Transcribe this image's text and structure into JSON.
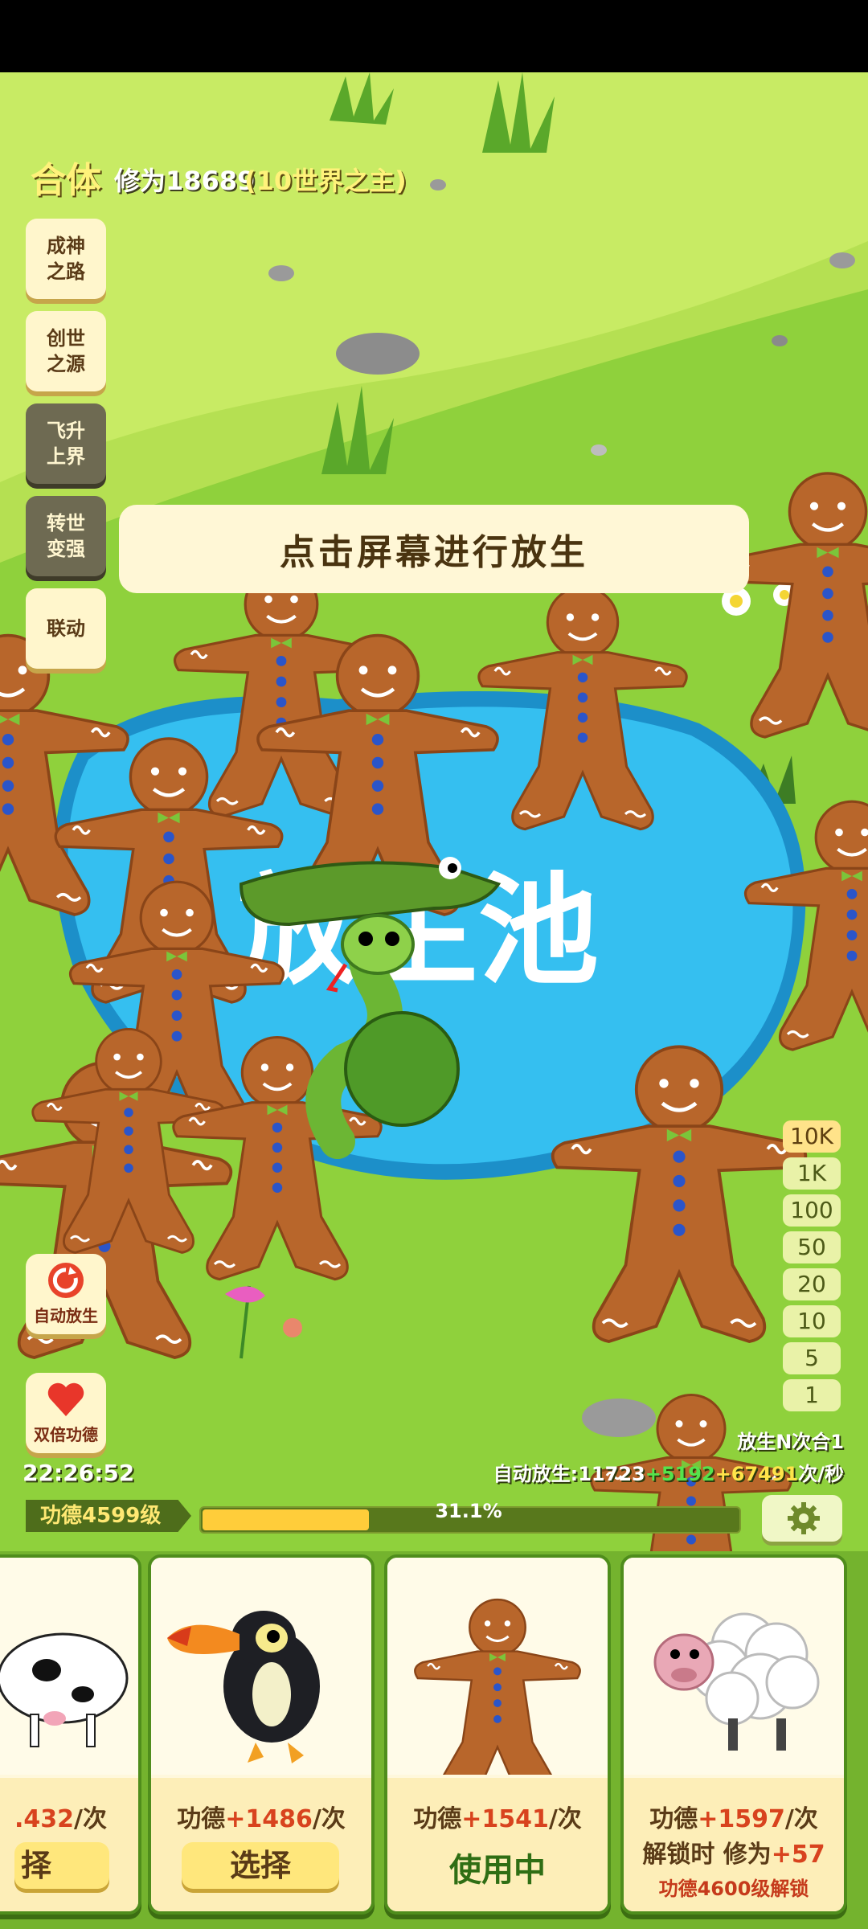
{
  "header": {
    "realm": "合体",
    "cultivation": "修为18689",
    "world_title": "(10世界之主)"
  },
  "menu": [
    {
      "label": "成神\n之路",
      "locked": false
    },
    {
      "label": "创世\n之源",
      "locked": false
    },
    {
      "label": "飞升\n上界",
      "locked": true
    },
    {
      "label": "转世\n变强",
      "locked": true
    },
    {
      "label": "联动",
      "locked": false
    }
  ],
  "hint": "点击屏幕进行放生",
  "pond_label": "放生池",
  "quantities": [
    "10K",
    "1K",
    "100",
    "50",
    "20",
    "10",
    "5",
    "1"
  ],
  "selected_quantity": "10K",
  "auto_release_button": "自动放生",
  "double_merit_button": "双倍功德",
  "timer": "22:26:52",
  "release_n_combine": "放生N次合1",
  "auto_rate": {
    "prefix": "自动放生:11723",
    "bonus1": "+5192",
    "bonus2": "+67491",
    "suffix": "次/秒"
  },
  "level": {
    "tag": "功德4599级",
    "progress_text": "31.1%",
    "progress": 0.311
  },
  "cards": [
    {
      "animal": "cow",
      "merit_value": ".432",
      "merit_suffix": "/次",
      "button": "择"
    },
    {
      "animal": "toucan",
      "merit_prefix": "功德",
      "merit_value": "+1486",
      "merit_suffix": "/次",
      "button": "选择"
    },
    {
      "animal": "gingerbread",
      "merit_prefix": "功德",
      "merit_value": "+1541",
      "merit_suffix": "/次",
      "status": "使用中"
    },
    {
      "animal": "sheep",
      "merit_prefix": "功德",
      "merit_value": "+1597",
      "merit_suffix": "/次",
      "unlock_prefix": "解锁时 修为",
      "unlock_value": "+57",
      "unlock_requirement": "功德4600级解锁"
    }
  ],
  "colors": {
    "grass": "#8fd13c",
    "pond": "#2fb6ea",
    "cookie": "#b8662b",
    "accent_yellow": "#ffe873"
  }
}
